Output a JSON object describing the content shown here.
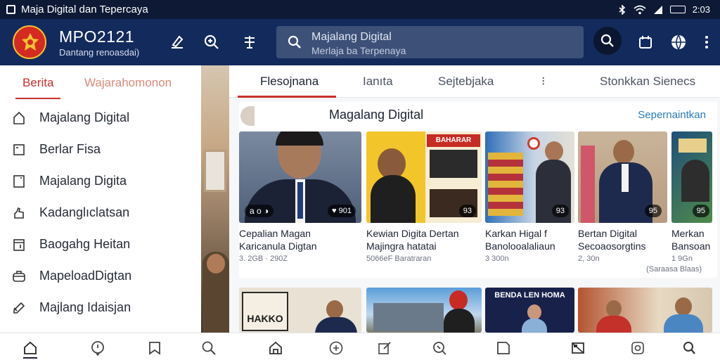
{
  "status_bar": {
    "title": "Maja Digital dan Tepercaya",
    "time": "2:03"
  },
  "header": {
    "brand_title": "MPO2121",
    "brand_subtitle": "Dantang renoasdai)",
    "search": {
      "line1": "Majalang Digital",
      "line2": "Merlaja ba Terpenaya"
    }
  },
  "drawer": {
    "tabs": [
      "Berita",
      "Wajarahomonon"
    ],
    "items": [
      {
        "label": "Majalang Digital",
        "icon": "home-icon"
      },
      {
        "label": "Berlar Fisa",
        "icon": "square-icon"
      },
      {
        "label": "Majalang Digita",
        "icon": "page-icon"
      },
      {
        "label": "Kadanglıclatsan",
        "icon": "hand-icon"
      },
      {
        "label": "Baogahg Heitan",
        "icon": "calendar-icon"
      },
      {
        "label": "MapeloadDigtan",
        "icon": "briefcase-icon"
      },
      {
        "label": "Majlang Idaisjan",
        "icon": "edit-icon"
      }
    ]
  },
  "main": {
    "tabs": [
      "Flesojnana",
      "Ianıta",
      "Sejtebjaka",
      "⁝",
      "Stonkkan Sienecs"
    ],
    "section": {
      "title": "Magalang Digital",
      "link": "Sepernaintkan",
      "more": "(Saraasa Blaas)",
      "cards": [
        {
          "line1": "Cepalian Magan",
          "line2": "Karicanula Digtan",
          "meta": "3. 2GB · 290Z",
          "chip": "♥ 901",
          "icon_row": "a o ◑"
        },
        {
          "line1": "Kewian Digita Dertan",
          "line2": "Majingra hatatai",
          "meta": "5066eF Baratraran",
          "chip": "93",
          "poster_text": "BAHARAR"
        },
        {
          "line1": "Karkan Higal f",
          "line2": "Banolooalaliaun",
          "meta": "3 300n",
          "chip": "93"
        },
        {
          "line1": "Bertan Digital",
          "line2": "Secoaosorgtins",
          "meta": "2, 30n",
          "chip": "95"
        },
        {
          "line1": "Merkan",
          "line2": "Bansoan",
          "meta": "1 9Gn",
          "chip": "95"
        }
      ],
      "row2": [
        {
          "text": "HAKKO"
        },
        {
          "text": ""
        },
        {
          "text": ""
        },
        {
          "text": "BENDA LEN HOMA"
        },
        {
          "text": ""
        }
      ]
    }
  },
  "colors": {
    "header": "#132a5c",
    "statusbar": "#0d1935",
    "accent": "#c9302c",
    "link": "#2a7bbf"
  }
}
